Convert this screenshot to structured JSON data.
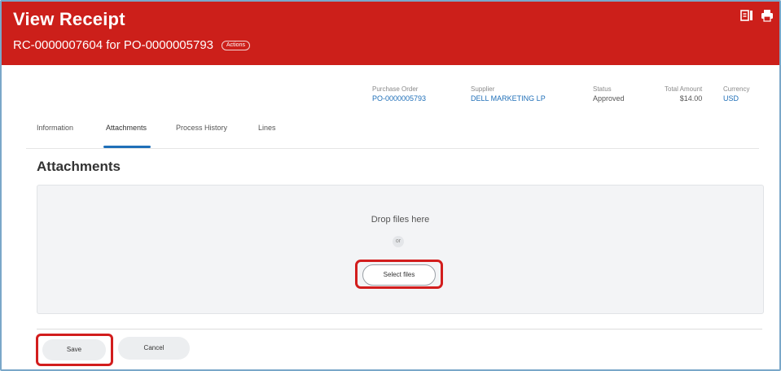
{
  "header": {
    "title": "View Receipt",
    "subtitle": "RC-0000007604 for PO-0000005793",
    "badge": "Actions",
    "bg_color": "#cc1f1a",
    "icons": [
      "related-actions-icon",
      "print-icon"
    ]
  },
  "summary": {
    "purchase_order": {
      "label": "Purchase Order",
      "value": "PO-0000005793"
    },
    "supplier": {
      "label": "Supplier",
      "value": "DELL MARKETING LP"
    },
    "status": {
      "label": "Status",
      "value": "Approved"
    },
    "total_amount": {
      "label": "Total Amount",
      "value": "$14.00"
    },
    "currency": {
      "label": "Currency",
      "value": "USD"
    }
  },
  "tabs": [
    {
      "label": "Information"
    },
    {
      "label": "Attachments"
    },
    {
      "label": "Process History"
    },
    {
      "label": "Lines"
    }
  ],
  "active_tab": "Attachments",
  "section": {
    "title": "Attachments",
    "drop_text": "Drop files here",
    "or_text": "or",
    "select_label": "Select files"
  },
  "footer": {
    "save_label": "Save",
    "cancel_label": "Cancel"
  },
  "colors": {
    "accent": "#1f6fb8",
    "highlight": "#d21d1d"
  }
}
